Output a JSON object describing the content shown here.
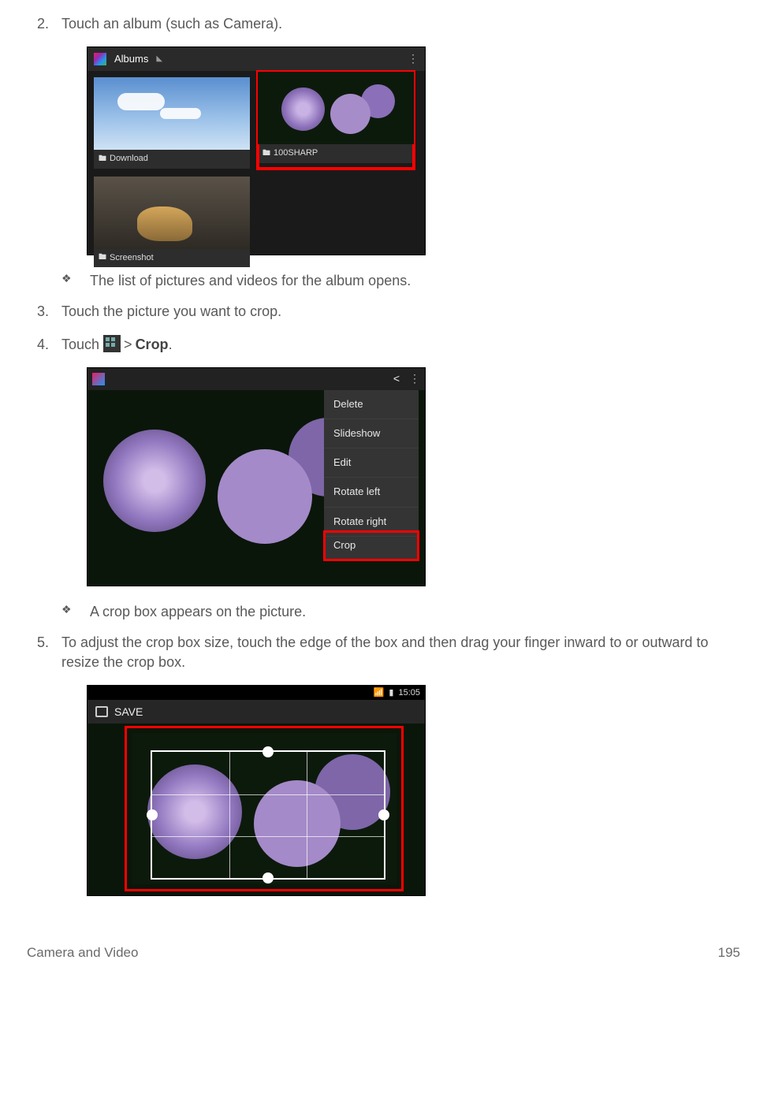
{
  "steps": {
    "s2": {
      "num": "2.",
      "text": "Touch an album (such as Camera)."
    },
    "s2_note": "The list of pictures and videos for the album opens.",
    "s3": {
      "num": "3.",
      "text": "Touch the picture you want to crop."
    },
    "s4": {
      "num": "4.",
      "pre": "Touch ",
      "gt": ">",
      "crop": "Crop",
      "post": "."
    },
    "s4_note": "A crop box appears on the picture.",
    "s5": {
      "num": "5.",
      "text": "To adjust the crop box size, touch the edge of the box and then drag your finger inward to or outward to resize the crop box."
    }
  },
  "fig1": {
    "title": "Albums",
    "albums": {
      "a0": "Download",
      "a1": "100SHARP",
      "a2": "Screenshot"
    }
  },
  "fig2": {
    "menu": {
      "m0": "Delete",
      "m1": "Slideshow",
      "m2": "Edit",
      "m3": "Rotate left",
      "m4": "Rotate right",
      "m5": "Crop"
    }
  },
  "fig3": {
    "save": "SAVE",
    "time": "15:05"
  },
  "footer": {
    "section": "Camera and Video",
    "page": "195"
  },
  "glyphs": {
    "diamond": "❖",
    "folder": "🖿",
    "share": "<",
    "dots": "⋮",
    "tri": "◣",
    "sig": "📶",
    "bat": "▮"
  }
}
